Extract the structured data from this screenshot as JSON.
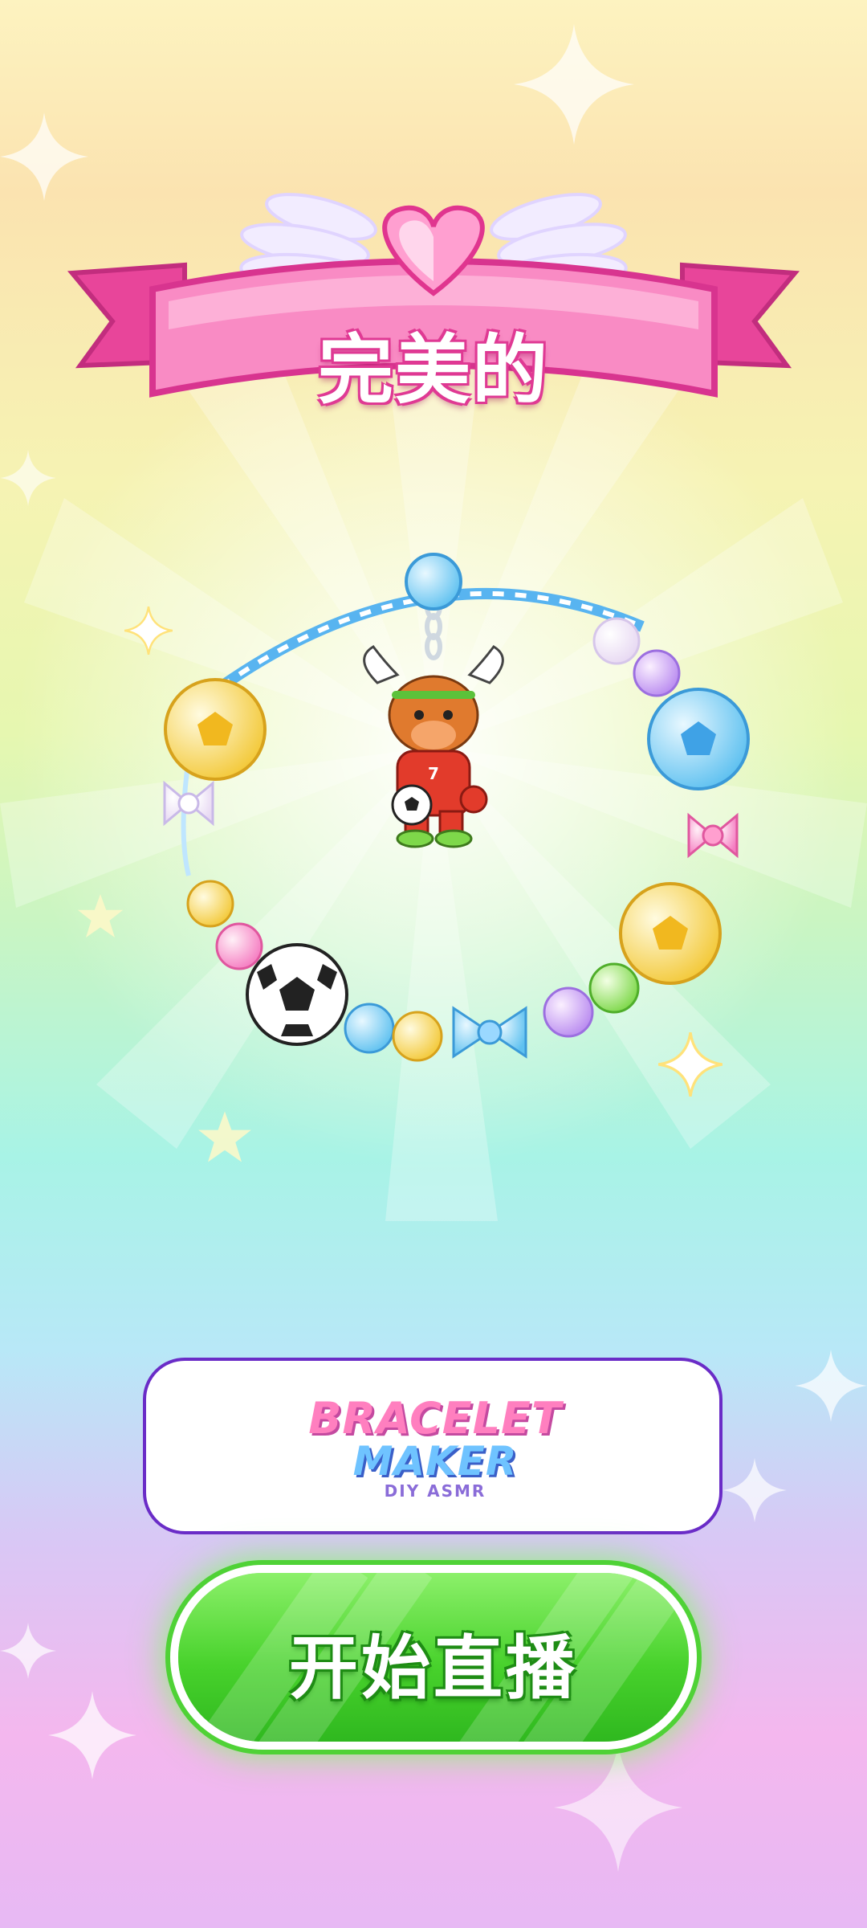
{
  "title": {
    "text": "完美的"
  },
  "logo": {
    "line1": "BRACELET",
    "line2": "MAKER",
    "line3": "DIY ASMR"
  },
  "start_button": {
    "label": "开始直播"
  },
  "charm": {
    "jersey_number": "7"
  },
  "colors": {
    "banner_pink": "#f25fae",
    "button_green": "#48d22c",
    "card_border": "#6a2cc7",
    "cord_blue": "#58b4f0"
  }
}
